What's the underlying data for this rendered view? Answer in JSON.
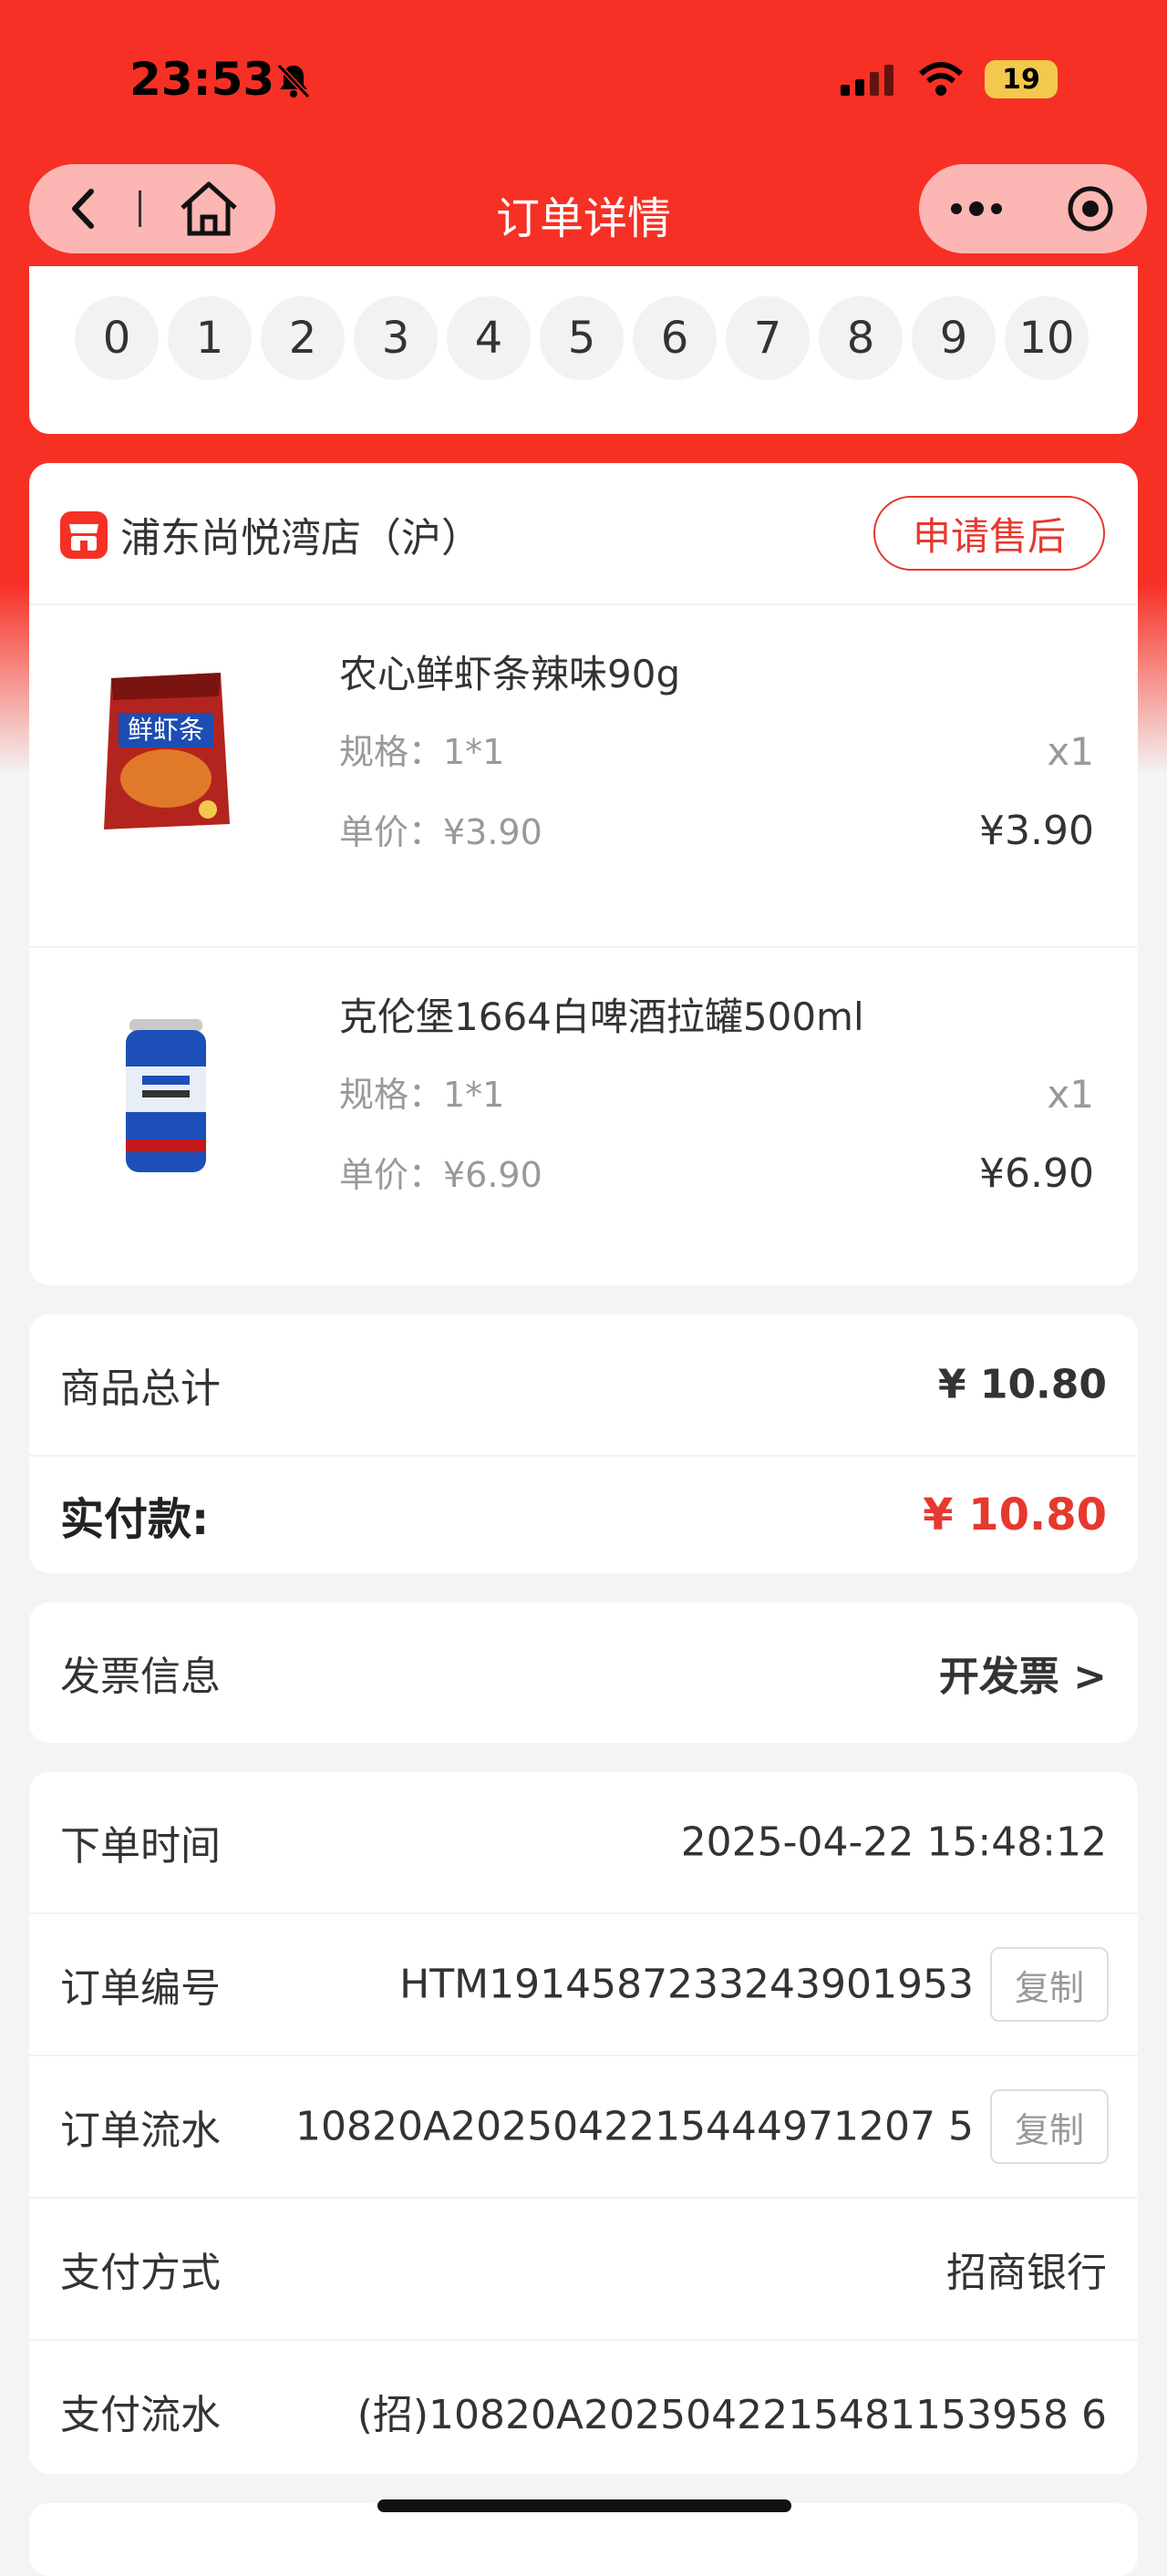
{
  "status_bar": {
    "time": "23:53",
    "battery": "19"
  },
  "nav": {
    "title": "订单详情"
  },
  "number_bar": [
    "0",
    "1",
    "2",
    "3",
    "4",
    "5",
    "6",
    "7",
    "8",
    "9",
    "10"
  ],
  "shop": {
    "name": "浦东尚悦湾店（沪）",
    "after_sale_label": "申请售后",
    "items": [
      {
        "name": "农心鲜虾条辣味90g",
        "spec": "规格：1*1",
        "unit_price": "单价：¥3.90",
        "qty": "x1",
        "price": "¥3.90",
        "image_text": "鲜虾条"
      },
      {
        "name": "克伦堡1664白啤酒拉罐500ml",
        "spec": "规格：1*1",
        "unit_price": "单价：¥6.90",
        "qty": "x1",
        "price": "¥6.90"
      }
    ]
  },
  "totals": {
    "goods_total_label": "商品总计",
    "goods_total_value": "¥ 10.80",
    "paid_label": "实付款:",
    "paid_value": "¥ 10.80"
  },
  "invoice": {
    "label": "发票信息",
    "action": "开发票 >"
  },
  "order_info": {
    "rows": [
      {
        "label": "下单时间",
        "value": "2025-04-22 15:48:12"
      },
      {
        "label": "订单编号",
        "value": "HTM1914587233243901953",
        "copy": "复制"
      },
      {
        "label": "订单流水",
        "value": "10820A2025042215444971207 5",
        "copy": "复制"
      },
      {
        "label": "支付方式",
        "value": "招商银行"
      },
      {
        "label": "支付流水",
        "value": "(招)10820A2025042215481153958 6"
      }
    ]
  },
  "colors": {
    "brand_red": "#f73025",
    "accent_red": "#e5392f"
  }
}
